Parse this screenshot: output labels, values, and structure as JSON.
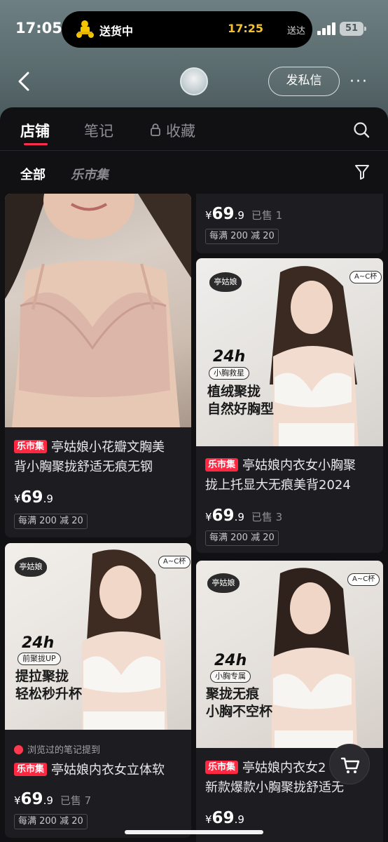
{
  "status": {
    "time": "17:05",
    "activity_label": "送货中",
    "eta_time": "17:25",
    "eta_suffix": "送达",
    "battery": "51"
  },
  "nav": {
    "message_button": "发私信",
    "more": "···"
  },
  "tabs": [
    {
      "label": "店铺"
    },
    {
      "label": "笔记"
    },
    {
      "label": "收藏"
    }
  ],
  "filters": {
    "all": "全部",
    "market": "乐市集"
  },
  "market_tag": "乐市集",
  "products": [
    {
      "title_line1": "亭姑娘小花瓣文胸美",
      "title_line2": "背小胸聚拢舒适无痕无钢",
      "currency": "¥",
      "price_main": "69",
      "price_dec": ".9",
      "sold": "",
      "coupon": "每满 200 减 20"
    },
    {
      "currency": "¥",
      "price_main": "69",
      "price_dec": ".9",
      "sold": "已售 1",
      "coupon": "每满 200 减 20"
    },
    {
      "brand": "亭姑娘",
      "cup": "A~C杯",
      "hours": "24h",
      "hours_pill": "小胸救星",
      "slogan_line1": "植绒聚拢",
      "slogan_line2": "自然好胸型",
      "title_line1": "亭姑娘内衣女小胸聚",
      "title_line2": "拢上托显大无痕美背2024",
      "currency": "¥",
      "price_main": "69",
      "price_dec": ".9",
      "sold": "已售 3",
      "coupon": "每满 200 减 20"
    },
    {
      "brand": "亭姑娘",
      "cup": "A~C杯",
      "hours": "24h",
      "hours_pill": "前聚拢UP",
      "slogan_line1": "提拉聚拢",
      "slogan_line2": "轻松秒升杯",
      "note_hint": "浏览过的笔记提到",
      "title_line1": "亭姑娘内衣女立体软",
      "currency": "¥",
      "price_main": "69",
      "price_dec": ".9",
      "sold": "已售 7",
      "coupon": "每满 200 减 20"
    },
    {
      "brand": "亭姑娘",
      "cup": "A~C杯",
      "hours": "24h",
      "hours_pill": "小胸专属",
      "slogan_line1": "聚拢无痕",
      "slogan_line2": "小胸不空杯",
      "title_line1": "亭姑娘内衣女2",
      "title_line2": "新款爆款小胸聚拢舒适无",
      "currency": "¥",
      "price_main": "69",
      "price_dec": ".9"
    }
  ],
  "colors": {
    "accent": "#ff2742",
    "panel_bg": "#111114",
    "card_bg": "#1d1d21",
    "eta": "#f2c230"
  }
}
